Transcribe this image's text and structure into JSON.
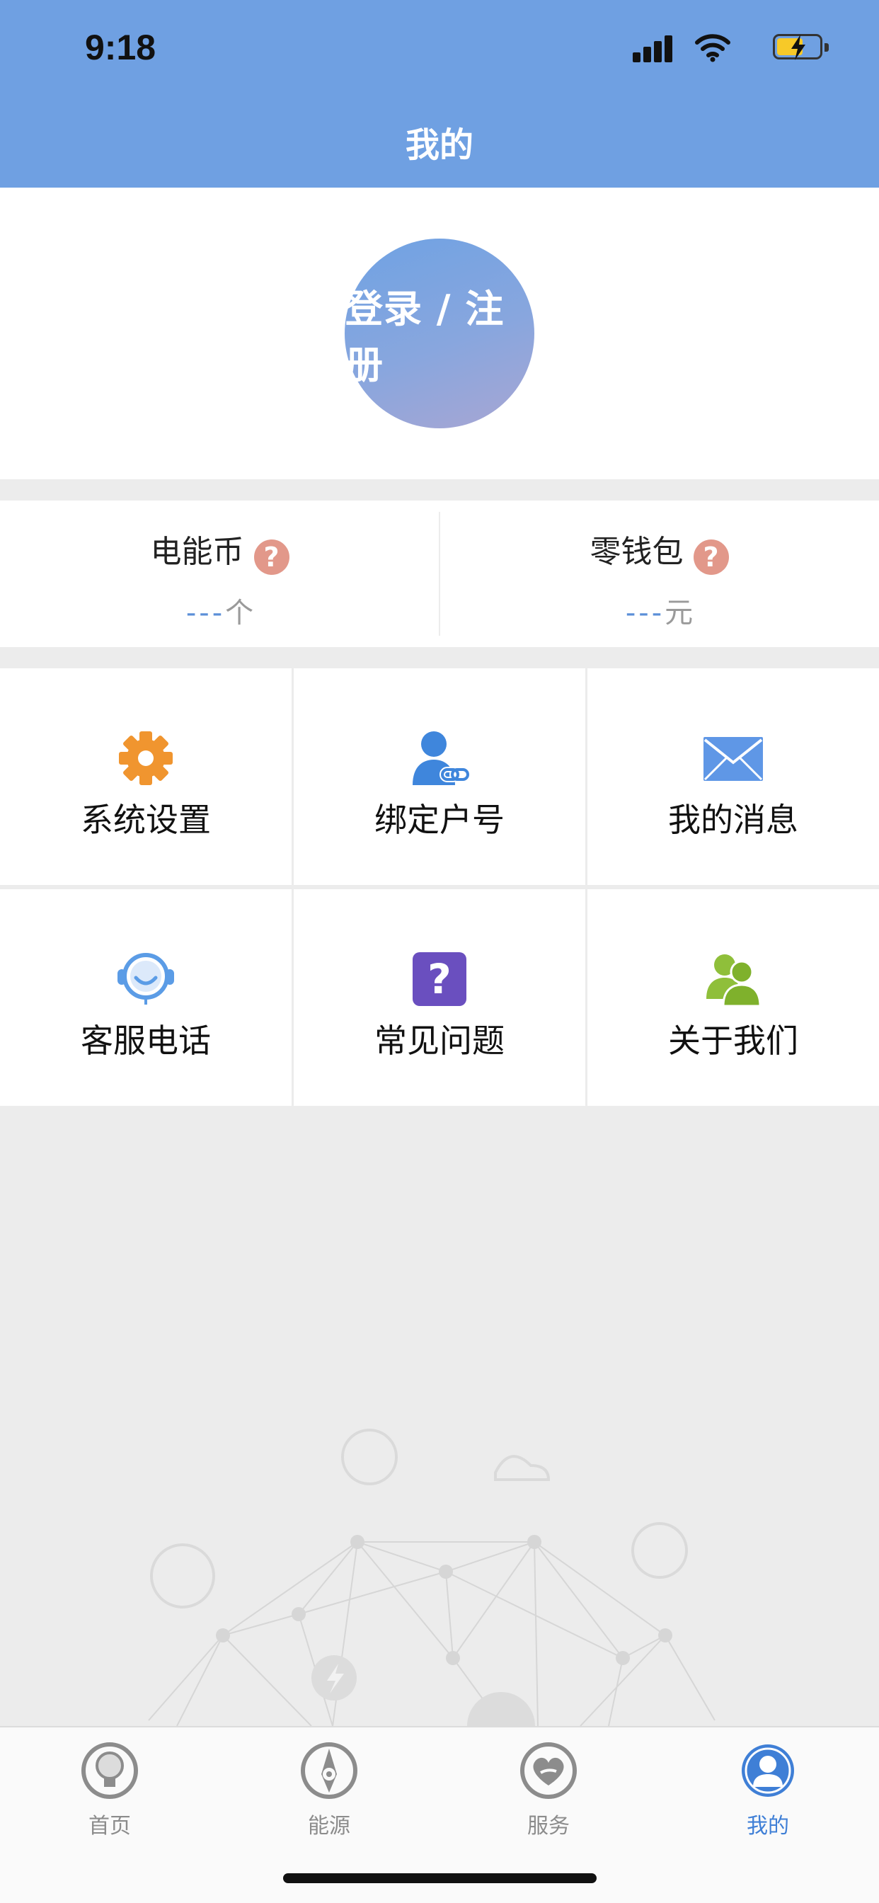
{
  "status_bar": {
    "time": "9:18",
    "icons": [
      "signal-icon",
      "wifi-icon",
      "battery-charging-icon"
    ]
  },
  "header": {
    "title": "我的"
  },
  "profile": {
    "login_label": "登录 / 注册"
  },
  "wallet": {
    "energy_coin": {
      "label": "电能币",
      "help_icon": "?",
      "value_dash": "---",
      "unit": "个"
    },
    "change_purse": {
      "label": "零钱包",
      "help_icon": "?",
      "value_dash": "---",
      "unit": "元"
    }
  },
  "menu": [
    {
      "label": "系统设置",
      "icon": "gear-icon",
      "color": "#f0952f"
    },
    {
      "label": "绑定户号",
      "icon": "user-link-icon",
      "color": "#3f86dc"
    },
    {
      "label": "我的消息",
      "icon": "envelope-icon",
      "color": "#5f97e6"
    },
    {
      "label": "客服电话",
      "icon": "headset-icon",
      "color": "#5b9ce6"
    },
    {
      "label": "常见问题",
      "icon": "question-box-icon",
      "glyph": "?",
      "color": "#6a4fbf"
    },
    {
      "label": "关于我们",
      "icon": "users-icon",
      "color": "#8fbf3a"
    }
  ],
  "tabs": [
    {
      "label": "首页",
      "icon": "lightbulb-icon",
      "active": false
    },
    {
      "label": "能源",
      "icon": "compass-icon",
      "active": false
    },
    {
      "label": "服务",
      "icon": "heart-hand-icon",
      "active": false
    },
    {
      "label": "我的",
      "icon": "person-icon",
      "active": true
    }
  ],
  "colors": {
    "header": "#6fa0e2",
    "active_tab": "#3f7fd6",
    "inactive_tab": "#8c8c8c",
    "help_badge": "#e2988a"
  }
}
